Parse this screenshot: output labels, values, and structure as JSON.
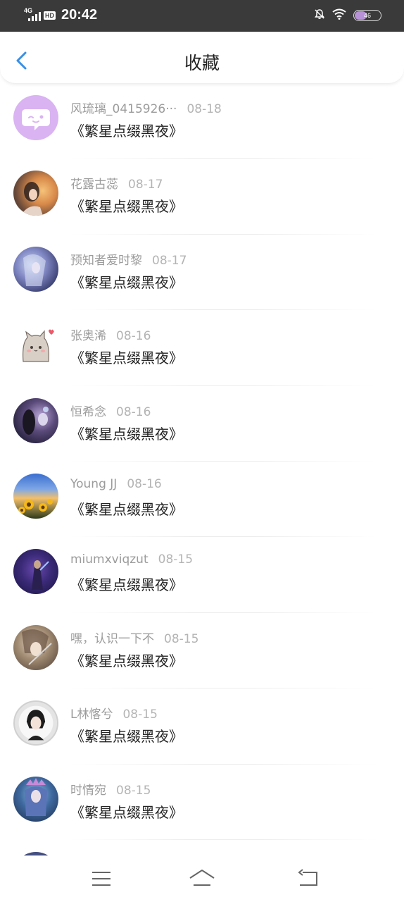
{
  "status_bar": {
    "network": "4G",
    "hd": "HD",
    "time": "20:42",
    "battery": "46",
    "battery_level": 0.46
  },
  "header": {
    "title": "收藏",
    "accent": "#3a8ee6"
  },
  "favorites": [
    {
      "user": "风琉璃_0415926···",
      "date": "08-18",
      "work": "《繁星点缀黑夜》",
      "avatar_icon": "chat-bubble-avatar-icon"
    },
    {
      "user": "花露古蕊",
      "date": "08-17",
      "work": "《繁星点缀黑夜》",
      "avatar_icon": "photo-avatar"
    },
    {
      "user": "预知者爱时黎",
      "date": "08-17",
      "work": "《繁星点缀黑夜》",
      "avatar_icon": "photo-avatar"
    },
    {
      "user": "张奥浠",
      "date": "08-16",
      "work": "《繁星点缀黑夜》",
      "avatar_icon": "cat-avatar"
    },
    {
      "user": "恒希念",
      "date": "08-16",
      "work": "《繁星点缀黑夜》",
      "avatar_icon": "photo-avatar"
    },
    {
      "user": "Young JJ",
      "date": "08-16",
      "work": "《繁星点缀黑夜》",
      "avatar_icon": "sunflower-avatar"
    },
    {
      "user": "miumxviqzut",
      "date": "08-15",
      "work": "《繁星点缀黑夜》",
      "avatar_icon": "photo-avatar"
    },
    {
      "user": "嘿，认识一下不",
      "date": "08-15",
      "work": "《繁星点缀黑夜》",
      "avatar_icon": "photo-avatar"
    },
    {
      "user": "L林愘兮",
      "date": "08-15",
      "work": "《繁星点缀黑夜》",
      "avatar_icon": "photo-avatar"
    },
    {
      "user": "时情宛",
      "date": "08-15",
      "work": "《繁星点缀黑夜》",
      "avatar_icon": "photo-avatar"
    },
    {
      "user": "",
      "date": "",
      "work": "",
      "avatar_icon": "photo-avatar"
    }
  ],
  "nav": {
    "menu_icon": "menu-icon",
    "home_icon": "home-icon",
    "back_icon": "back-icon"
  }
}
